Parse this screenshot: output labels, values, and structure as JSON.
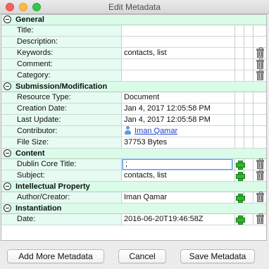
{
  "window": {
    "title": "Edit Metadata"
  },
  "sections": [
    {
      "title": "General",
      "rows": [
        {
          "label": "Title:",
          "value": ""
        },
        {
          "label": "Description:",
          "value": ""
        },
        {
          "label": "Keywords:",
          "value": "contacts, list"
        },
        {
          "label": "Comment:",
          "value": ""
        },
        {
          "label": "Category:",
          "value": ""
        }
      ]
    },
    {
      "title": "Submission/Modification",
      "rows": [
        {
          "label": "Resource Type:",
          "value": "Document"
        },
        {
          "label": "Creation Date:",
          "value": "Jan 4, 2017 12:05:58 PM"
        },
        {
          "label": "Last Update:",
          "value": "Jan 4, 2017 12:05:58 PM"
        },
        {
          "label": "Contributor:",
          "value": "Iman Qamar"
        },
        {
          "label": "File Size:",
          "value": "37753 Bytes"
        }
      ]
    },
    {
      "title": "Content",
      "rows": [
        {
          "label": "Dublin Core Title:",
          "value": ";"
        },
        {
          "label": "Subject:",
          "value": "contacts, list"
        }
      ]
    },
    {
      "title": "Intellectual Property",
      "rows": [
        {
          "label": "Author/Creator:",
          "value": "Iman Qamar"
        }
      ]
    },
    {
      "title": "Instantiation",
      "rows": [
        {
          "label": "Date:",
          "value": "2016-06-20T19:46:58Z"
        }
      ]
    }
  ],
  "buttons": {
    "add_more": "Add More Metadata",
    "cancel": "Cancel",
    "save": "Save Metadata"
  },
  "icons": {
    "section_toggle": "collapse-minus-icon",
    "add": "plus-icon",
    "delete": "trash-icon",
    "contributor": "person-icon"
  },
  "colors": {
    "section_bg": "#d9fbe8",
    "label_bg": "#e6fbf1",
    "link": "#1f3fd1",
    "add_green": "#2fb52f"
  }
}
